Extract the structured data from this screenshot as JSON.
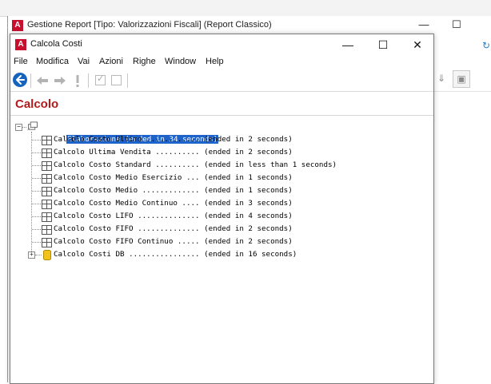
{
  "background_window": {
    "title": "Gestione Report [Tipo: Valorizzazioni Fiscali] (Report Classico)",
    "controls": {
      "minimize": "—",
      "maximize": "☐"
    }
  },
  "window": {
    "title": "Calcola Costi",
    "controls": {
      "minimize": "—",
      "maximize": "☐",
      "close": "✕"
    }
  },
  "menu": [
    "File",
    "Modifica",
    "Vai",
    "Azioni",
    "Righe",
    "Window",
    "Help"
  ],
  "toolbar": {
    "icons": [
      "back-icon",
      "arrow-left-icon",
      "arrow-right-icon",
      "exclamation-icon",
      "checkbox-checked-icon",
      "checkbox-icon"
    ]
  },
  "section": {
    "title": "Calcolo"
  },
  "tree": {
    "root": {
      "name": "Elaborazione",
      "status": "(ended in 34 seconds)"
    },
    "items": [
      {
        "name": "Calcolo Costo Ultimo ............",
        "status": "(ended in 2 seconds)",
        "icon": "table-icon"
      },
      {
        "name": "Calcolo Ultima Vendita ..........",
        "status": "(ended in 2 seconds)",
        "icon": "table-icon"
      },
      {
        "name": "Calcolo Costo Standard ..........",
        "status": "(ended in less than 1 seconds)",
        "icon": "table-icon"
      },
      {
        "name": "Calcolo Costo Medio Esercizio ...",
        "status": "(ended in 1 seconds)",
        "icon": "table-icon"
      },
      {
        "name": "Calcolo Costo Medio .............",
        "status": "(ended in 1 seconds)",
        "icon": "table-icon"
      },
      {
        "name": "Calcolo Costo Medio Continuo ....",
        "status": "(ended in 3 seconds)",
        "icon": "table-icon"
      },
      {
        "name": "Calcolo Costo LIFO ..............",
        "status": "(ended in 4 seconds)",
        "icon": "table-icon"
      },
      {
        "name": "Calcolo Costo FIFO ..............",
        "status": "(ended in 2 seconds)",
        "icon": "table-icon"
      },
      {
        "name": "Calcolo Costo FIFO Continuo .....",
        "status": "(ended in 2 seconds)",
        "icon": "table-icon"
      },
      {
        "name": "Calcolo Costi DB ................",
        "status": "(ended in 16 seconds)",
        "icon": "database-icon",
        "expandable": true
      }
    ]
  },
  "colors": {
    "accent": "#b31b1b",
    "selection": "#1e63c9",
    "back_button": "#1565c0",
    "app_icon": "#c8102e"
  }
}
